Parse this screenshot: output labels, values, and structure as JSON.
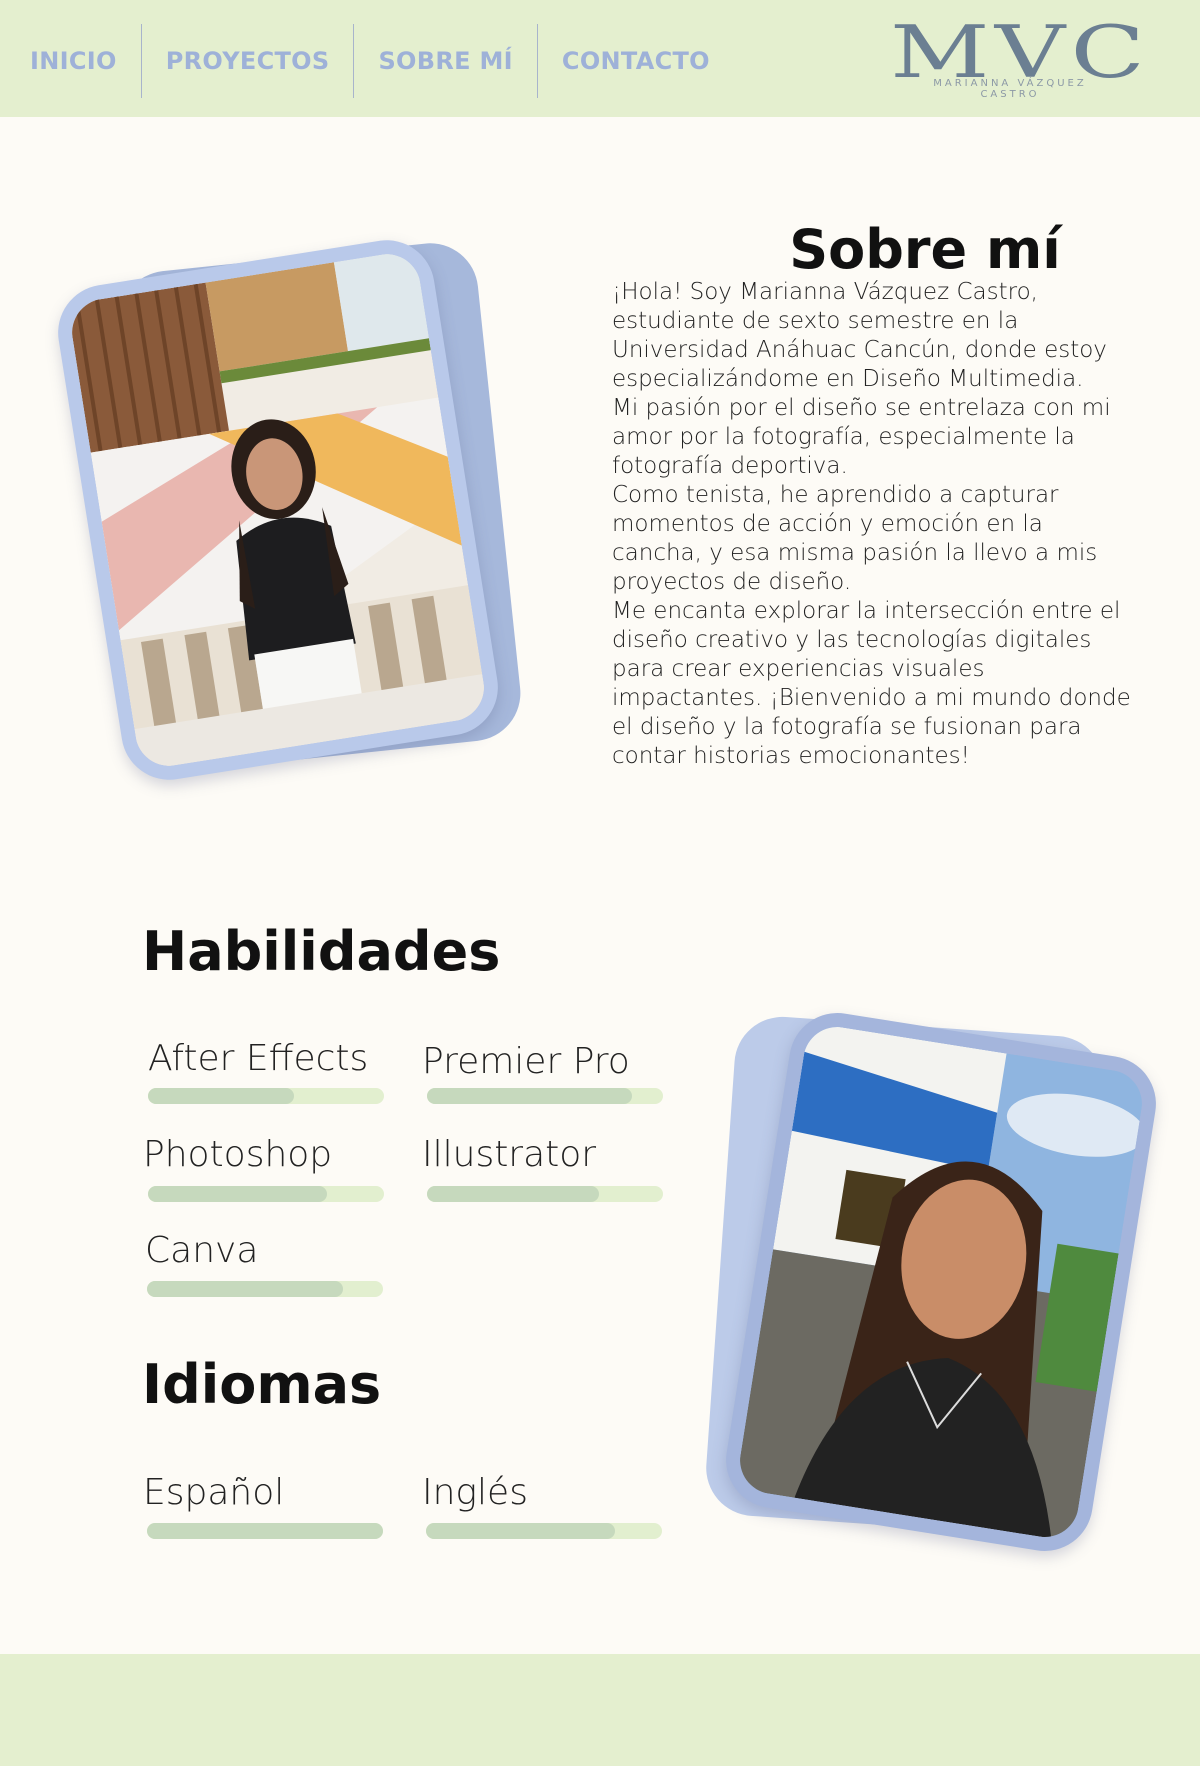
{
  "nav": {
    "items": [
      {
        "label": "INICIO"
      },
      {
        "label": "PROYECTOS"
      },
      {
        "label": "SOBRE MÍ"
      },
      {
        "label": "CONTACTO"
      }
    ]
  },
  "logo": {
    "mark": "MVC",
    "subtitle": "MARIANNA VÁZQUEZ CASTRO"
  },
  "about": {
    "title": "Sobre mí",
    "paragraphs": [
      "¡Hola! Soy Marianna Vázquez Castro, estudiante de sexto semestre en la Universidad Anáhuac Cancún, donde estoy especializándome en Diseño Multimedia.",
      "Mi pasión por el diseño se entrelaza con mi amor por la fotografía, especialmente la fotografía deportiva.",
      "Como tenista, he aprendido a capturar momentos de acción y emoción en la cancha, y esa misma pasión la llevo a mis proyectos de diseño.",
      "Me encanta explorar la intersección entre el diseño creativo y las tecnologías digitales para crear experiencias visuales impactantes. ¡Bienvenido a mi mundo donde el diseño y la fotografía se fusionan para contar historias emocionantes!"
    ]
  },
  "skills": {
    "title": "Habilidades",
    "items": [
      {
        "label": "After Effects",
        "level": 0.62
      },
      {
        "label": "Premier Pro",
        "level": 0.87
      },
      {
        "label": "Photoshop",
        "level": 0.76
      },
      {
        "label": "Illustrator",
        "level": 0.73
      },
      {
        "label": "Canva",
        "level": 0.83
      }
    ]
  },
  "languages": {
    "title": "Idiomas",
    "items": [
      {
        "label": "Español",
        "level": 1.0
      },
      {
        "label": "Inglés",
        "level": 0.8
      }
    ]
  },
  "colors": {
    "header_bg": "#e4efcf",
    "page_bg": "#fdfbf6",
    "nav_text": "#9eb1d8",
    "frame_blue": "#b9c9ea",
    "bar_track": "#e2efcf",
    "bar_fill": "#c6d9bd"
  }
}
